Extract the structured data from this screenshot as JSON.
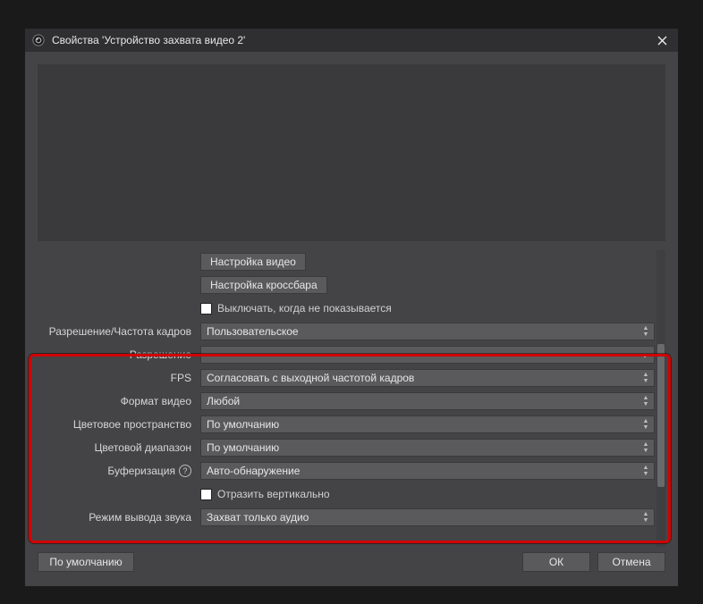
{
  "titlebar": {
    "title": "Свойства 'Устройство захвата видео 2'"
  },
  "buttons": {
    "video_settings": "Настройка видео",
    "crossbar_settings": "Настройка кроссбара"
  },
  "checkboxes": {
    "turn_off_when_hidden": "Выключать, когда не показывается",
    "flip_vertical": "Отразить вертикально"
  },
  "labels": {
    "resolution_fps": "Разрешение/Частота кадров",
    "resolution": "Разрешение",
    "fps": "FPS",
    "video_format": "Формат видео",
    "color_space": "Цветовое пространство",
    "color_range": "Цветовой диапазон",
    "buffering": "Буферизация",
    "audio_output_mode": "Режим вывода звука"
  },
  "values": {
    "resolution_fps": "Пользовательское",
    "resolution": "",
    "fps": "Согласовать с выходной частотой кадров",
    "video_format": "Любой",
    "color_space": "По умолчанию",
    "color_range": "По умолчанию",
    "buffering": "Авто-обнаружение",
    "audio_output_mode": "Захват только аудио"
  },
  "footer": {
    "defaults": "По умолчанию",
    "ok": "ОК",
    "cancel": "Отмена"
  }
}
